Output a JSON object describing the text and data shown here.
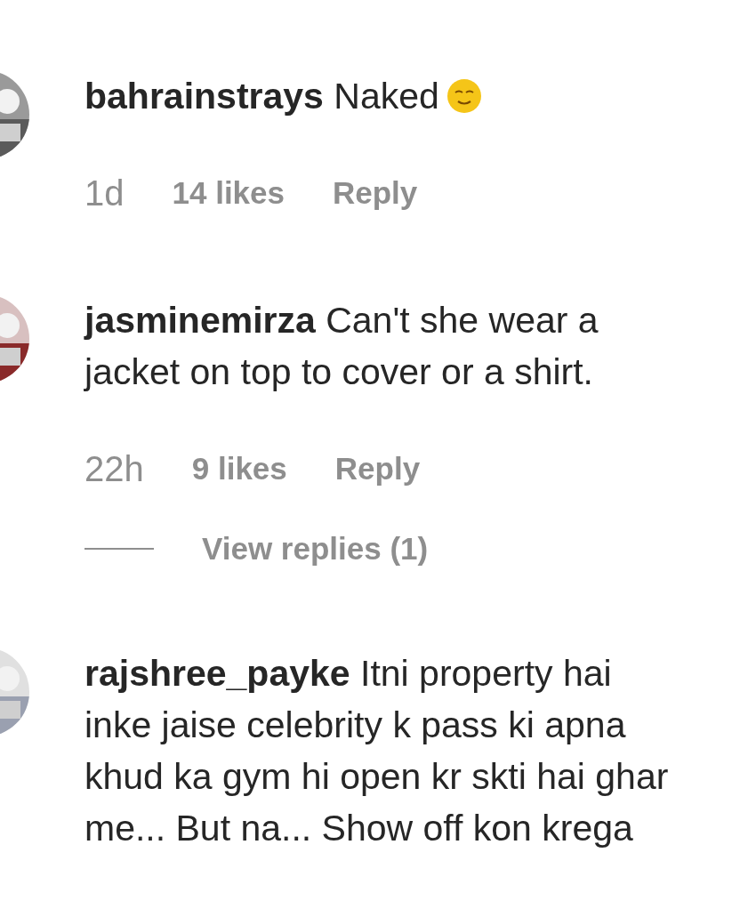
{
  "comments": [
    {
      "username": "bahrainstrays",
      "text": "Naked",
      "emoji": true,
      "time": "1d",
      "likes": "14 likes",
      "reply": "Reply"
    },
    {
      "username": "jasminemirza",
      "text": "Can't she wear a jacket on top to cover or a shirt.",
      "emoji": false,
      "time": "22h",
      "likes": "9 likes",
      "reply": "Reply",
      "replies": "View replies (1)"
    },
    {
      "username": "rajshree_payke",
      "text": "Itni property hai inke jaise celebrity k pass ki apna khud ka gym hi open kr skti hai ghar me... But na... Show off kon krega",
      "emoji": false
    }
  ]
}
